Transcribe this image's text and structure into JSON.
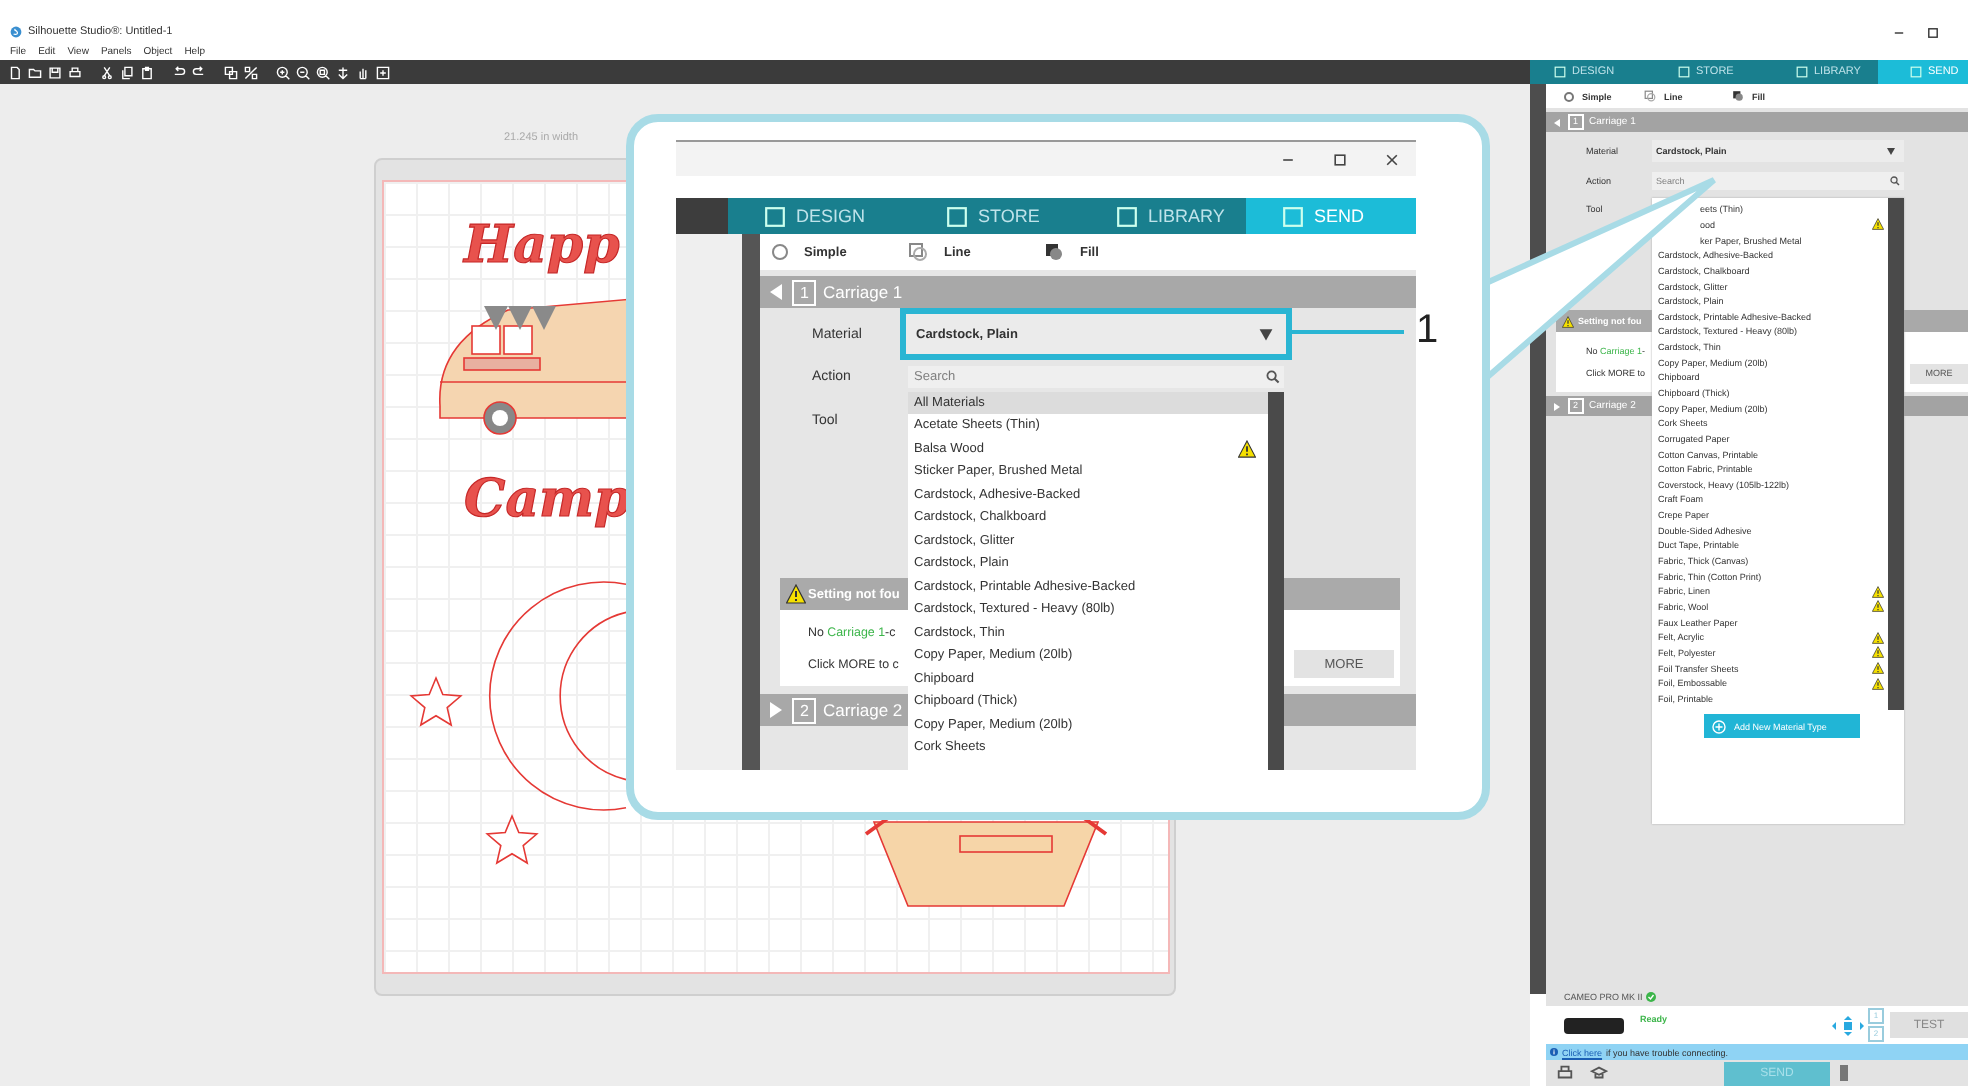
{
  "window": {
    "title": "Silhouette Studio®: Untitled-1"
  },
  "menu": [
    "File",
    "Edit",
    "View",
    "Panels",
    "Object",
    "Help"
  ],
  "canvas": {
    "width_label": "21.245 in width",
    "lettering": [
      "Happ",
      "Camp"
    ]
  },
  "panel": {
    "tabs": [
      {
        "label": "DESIGN",
        "selected": false
      },
      {
        "label": "STORE",
        "selected": false
      },
      {
        "label": "LIBRARY",
        "selected": false
      },
      {
        "label": "SEND",
        "selected": true
      }
    ],
    "modes": [
      {
        "kind": "radio",
        "label": "Simple",
        "checked": false
      },
      {
        "kind": "line",
        "label": "Line"
      },
      {
        "kind": "fill",
        "label": "Fill"
      }
    ],
    "carriages": [
      {
        "number": "1",
        "label": "Carriage 1",
        "expanded": true
      },
      {
        "number": "2",
        "label": "Carriage 2",
        "expanded": false
      }
    ],
    "material": {
      "label": "Material",
      "value": "Cardstock, Plain"
    },
    "action": {
      "label": "Action",
      "placeholder": "Search"
    },
    "tool": {
      "label": "Tool"
    },
    "materials": [
      {
        "kind": "cut",
        "label": "eets (Thin)",
        "warning": false
      },
      {
        "kind": "cut",
        "label": "ood",
        "warning": true
      },
      {
        "kind": "cut",
        "label": "ker Paper, Brushed Metal",
        "warning": false
      },
      {
        "kind": "item",
        "label": "Cardstock, Adhesive-Backed",
        "warning": false
      },
      {
        "kind": "item",
        "label": "Cardstock, Chalkboard",
        "warning": false
      },
      {
        "kind": "item",
        "label": "Cardstock, Glitter",
        "warning": false
      },
      {
        "kind": "item",
        "label": "Cardstock, Plain",
        "warning": false
      },
      {
        "kind": "item",
        "label": "Cardstock, Printable Adhesive-Backed",
        "warning": false
      },
      {
        "kind": "item",
        "label": "Cardstock, Textured - Heavy (80lb)",
        "warning": false
      },
      {
        "kind": "item",
        "label": "Cardstock, Thin",
        "warning": false
      },
      {
        "kind": "item",
        "label": "Copy Paper, Medium (20lb)",
        "warning": false
      },
      {
        "kind": "item",
        "label": "Chipboard",
        "warning": false
      },
      {
        "kind": "item",
        "label": "Chipboard (Thick)",
        "warning": false
      },
      {
        "kind": "item",
        "label": "Copy Paper, Medium (20lb)",
        "warning": false
      },
      {
        "kind": "item",
        "label": "Cork Sheets",
        "warning": false
      },
      {
        "kind": "item",
        "label": "Corrugated Paper",
        "warning": false
      },
      {
        "kind": "item",
        "label": "Cotton Canvas, Printable",
        "warning": false
      },
      {
        "kind": "item",
        "label": "Cotton Fabric, Printable",
        "warning": false
      },
      {
        "kind": "item",
        "label": "Coverstock, Heavy (105lb-122lb)",
        "warning": false
      },
      {
        "kind": "item",
        "label": "Craft Foam",
        "warning": false
      },
      {
        "kind": "item",
        "label": "Crepe Paper",
        "warning": false
      },
      {
        "kind": "item",
        "label": "Double-Sided Adhesive",
        "warning": false
      },
      {
        "kind": "item",
        "label": "Duct Tape, Printable",
        "warning": false
      },
      {
        "kind": "item",
        "label": "Fabric, Thick (Canvas)",
        "warning": false
      },
      {
        "kind": "item",
        "label": "Fabric, Thin (Cotton Print)",
        "warning": false
      },
      {
        "kind": "item",
        "label": "Fabric, Linen",
        "warning": true
      },
      {
        "kind": "item",
        "label": "Fabric, Wool",
        "warning": true
      },
      {
        "kind": "item",
        "label": "Faux Leather Paper",
        "warning": false
      },
      {
        "kind": "item",
        "label": "Felt, Acrylic",
        "warning": true
      },
      {
        "kind": "item",
        "label": "Felt, Polyester",
        "warning": true
      },
      {
        "kind": "item",
        "label": "Foil Transfer Sheets",
        "warning": true
      },
      {
        "kind": "item",
        "label": "Foil, Embossable",
        "warning": true
      },
      {
        "kind": "item",
        "label": "Foil, Printable",
        "warning": false
      }
    ],
    "add_material": "Add New Material Type",
    "notice": {
      "title": "Setting not fou",
      "before": "No ",
      "link": "Carriage 1",
      "after": "-",
      "line2": "Click MORE to",
      "button": "MORE"
    },
    "device": {
      "name": "CAMEO PRO MK II",
      "connected": true,
      "status": "Ready",
      "carriage_buttons": [
        "1",
        "2"
      ],
      "test": "TEST",
      "help_link": "Click here",
      "help_text": "if you have trouble connecting.",
      "send": "SEND"
    }
  },
  "callout": {
    "marker": "1",
    "tabs": [
      {
        "label": "DESIGN",
        "selected": false
      },
      {
        "label": "STORE",
        "selected": false
      },
      {
        "label": "LIBRARY",
        "selected": false
      },
      {
        "label": "SEND",
        "selected": true
      }
    ],
    "modes": [
      {
        "kind": "radio",
        "label": "Simple",
        "checked": false
      },
      {
        "kind": "line",
        "label": "Line"
      },
      {
        "kind": "fill",
        "label": "Fill"
      }
    ],
    "carriages": [
      {
        "number": "1",
        "label": "Carriage 1",
        "expanded": true
      },
      {
        "number": "2",
        "label": "Carriage 2",
        "expanded": false
      }
    ],
    "material": {
      "label": "Material",
      "value": "Cardstock, Plain"
    },
    "action": {
      "label": "Action",
      "placeholder": "Search"
    },
    "tool": {
      "label": "Tool"
    },
    "materials": [
      {
        "kind": "header",
        "label": "All Materials",
        "warning": false
      },
      {
        "kind": "item",
        "label": "Acetate Sheets (Thin)",
        "warning": false
      },
      {
        "kind": "item",
        "label": "Balsa Wood",
        "warning": true
      },
      {
        "kind": "item",
        "label": "Sticker Paper, Brushed Metal",
        "warning": false
      },
      {
        "kind": "item",
        "label": "Cardstock, Adhesive-Backed",
        "warning": false
      },
      {
        "kind": "item",
        "label": "Cardstock, Chalkboard",
        "warning": false
      },
      {
        "kind": "item",
        "label": "Cardstock, Glitter",
        "warning": false
      },
      {
        "kind": "item",
        "label": "Cardstock, Plain",
        "warning": false
      },
      {
        "kind": "item",
        "label": "Cardstock, Printable Adhesive-Backed",
        "warning": false
      },
      {
        "kind": "item",
        "label": "Cardstock, Textured - Heavy (80lb)",
        "warning": false
      },
      {
        "kind": "item",
        "label": "Cardstock, Thin",
        "warning": false
      },
      {
        "kind": "item",
        "label": "Copy Paper, Medium (20lb)",
        "warning": false
      },
      {
        "kind": "item",
        "label": "Chipboard",
        "warning": false
      },
      {
        "kind": "item",
        "label": "Chipboard (Thick)",
        "warning": false
      },
      {
        "kind": "item",
        "label": "Copy Paper, Medium (20lb)",
        "warning": false
      },
      {
        "kind": "item",
        "label": "Cork Sheets",
        "warning": false
      }
    ],
    "notice": {
      "title": "Setting not fou",
      "before": "No ",
      "link": "Carriage 1",
      "after": "-c",
      "line2": "Click MORE to c",
      "button": "MORE"
    }
  }
}
